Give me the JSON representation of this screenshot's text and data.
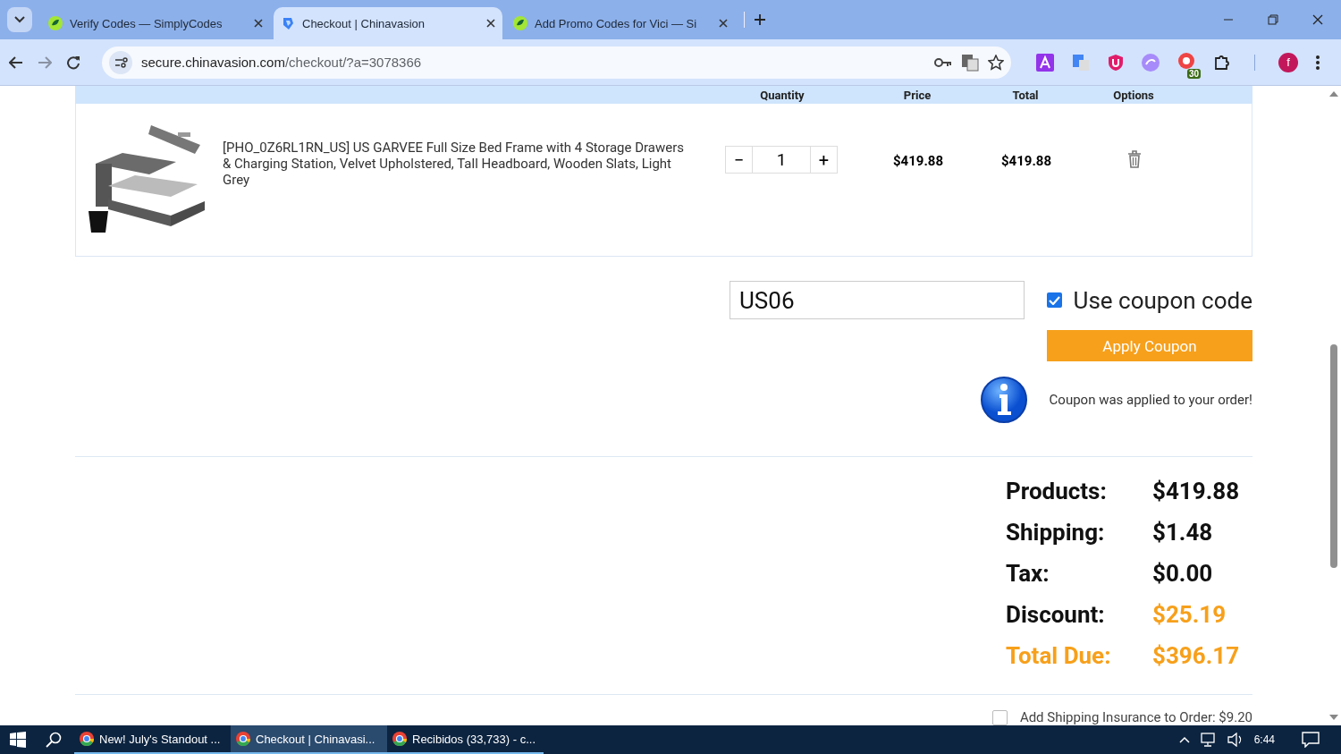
{
  "browser": {
    "tabs": [
      {
        "title": "Verify Codes — SimplyCodes",
        "selected": false,
        "kind": "leaf"
      },
      {
        "title": "Checkout | Chinavasion",
        "selected": true,
        "kind": "shop"
      },
      {
        "title": "Add Promo Codes for Vici — Si",
        "selected": false,
        "kind": "leaf"
      }
    ],
    "url_host": "secure.chinavasion.com",
    "url_path": "/checkout/?a=3078366",
    "extension_badge": "30",
    "profile_initial": "f"
  },
  "cart": {
    "columns": [
      "Quantity",
      "Price",
      "Total",
      "Options"
    ],
    "items": [
      {
        "name": "[PHO_0Z6RL1RN_US] US GARVEE Full Size Bed Frame with 4 Storage Drawers & Charging Station, Velvet Upholstered, Tall Headboard, Wooden Slats, Light Grey",
        "decrement": "−",
        "quantity": "1",
        "increment": "+",
        "price": "$419.88",
        "total": "$419.88"
      }
    ]
  },
  "coupon": {
    "code": "US06",
    "use_coupon": {
      "label": "Use coupon code",
      "checked": true
    },
    "apply_button": "Apply Coupon",
    "message": "Coupon was applied to your order!"
  },
  "totals": [
    {
      "label": "Products:",
      "value": "$419.88",
      "kind": "normal"
    },
    {
      "label": "Shipping:",
      "value": "$1.48",
      "kind": "normal"
    },
    {
      "label": "Tax:",
      "value": "$0.00",
      "kind": "normal"
    },
    {
      "label": "Discount:",
      "value": "$25.19",
      "kind": "discount"
    },
    {
      "label": "Total Due:",
      "value": "$396.17",
      "kind": "due"
    }
  ],
  "insurance": {
    "label": "Add Shipping Insurance to Order: $9.20",
    "checked": false
  },
  "taskbar": {
    "items": [
      {
        "title": "New! July's Standout ...",
        "selected": false
      },
      {
        "title": "Checkout | Chinavasi...",
        "selected": true
      },
      {
        "title": "Recibidos (33,733) - c...",
        "selected": false
      }
    ],
    "time": "6:44"
  }
}
